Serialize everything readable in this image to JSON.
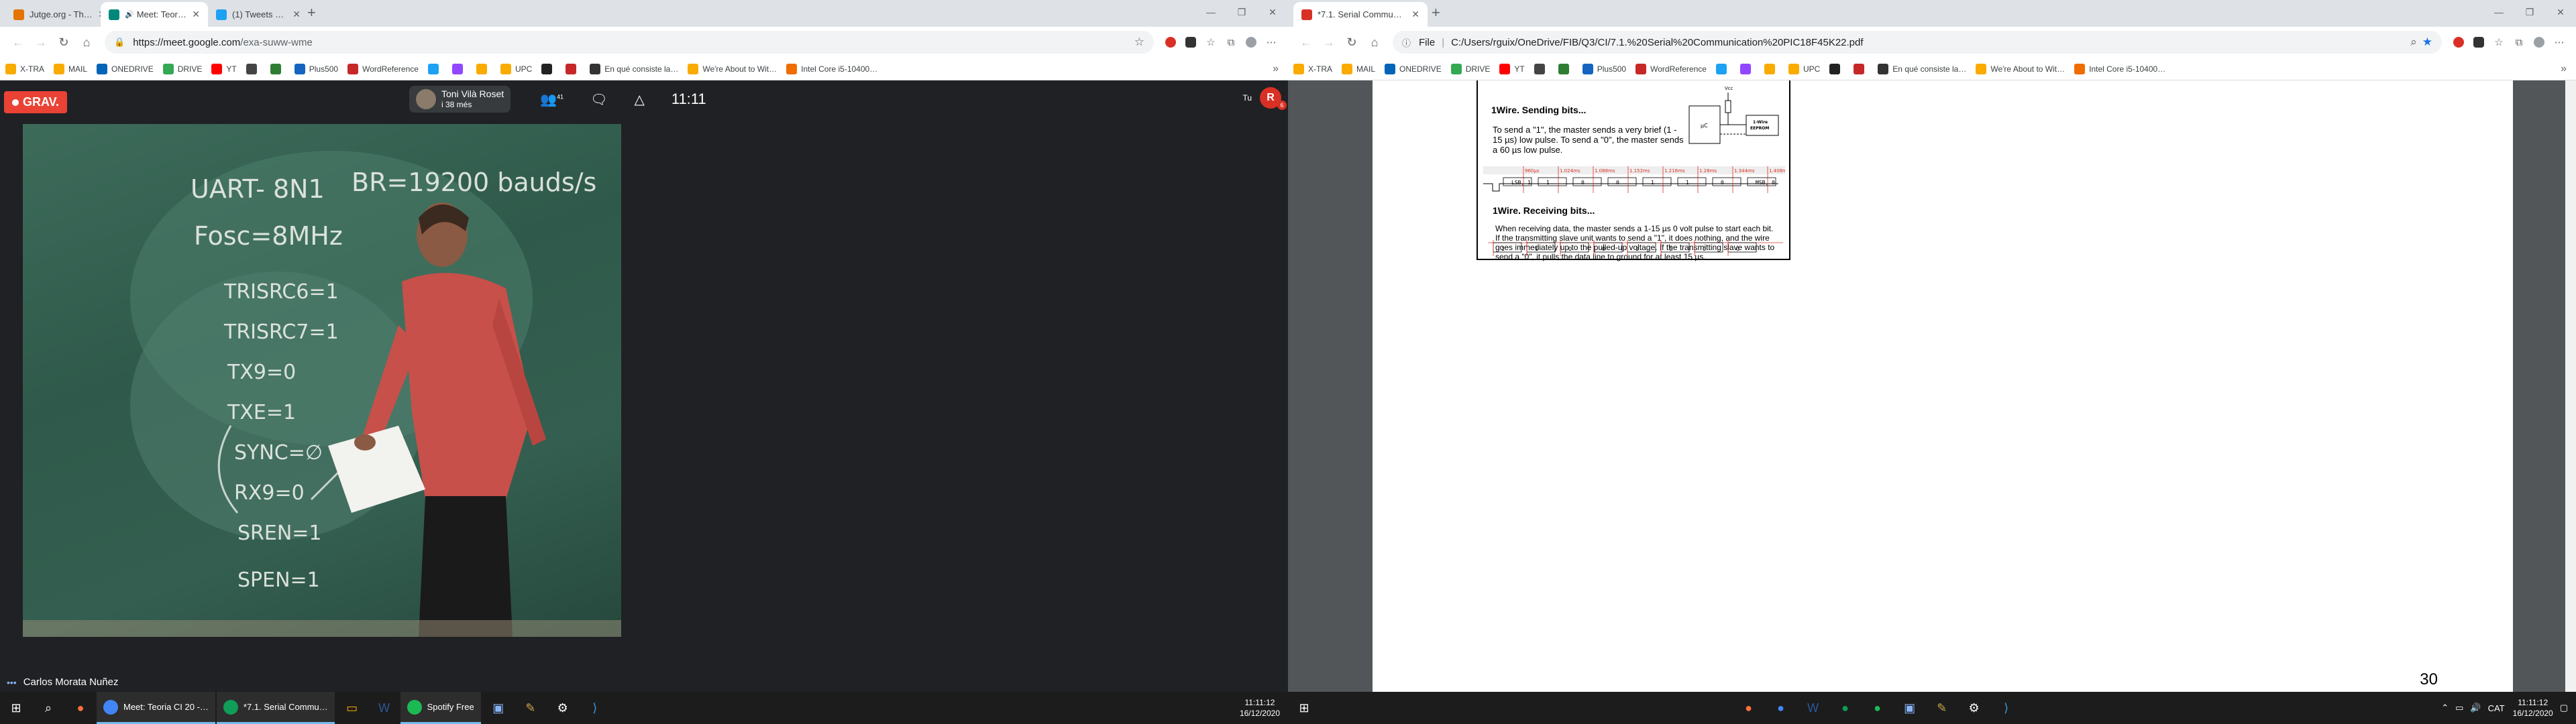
{
  "left_screen": {
    "tabs": [
      {
        "title": "Jutge.org - The Purge FIB Q1 20…",
        "fav_color": "#e37400",
        "active": false
      },
      {
        "title": "Meet: Teoria CI 20 - Busos",
        "fav_color": "#00897b",
        "active": true,
        "audio": "🔊"
      },
      {
        "title": "(1) Tweets más recientes / Twitt…",
        "fav_color": "#1da1f2",
        "active": false
      }
    ],
    "url": {
      "host": "https://meet.google.com",
      "rest": "/exa-suww-wme"
    },
    "bookmarks": [
      {
        "label": "X-TRA",
        "color": "#f9ab00"
      },
      {
        "label": "MAIL",
        "color": "#f9ab00"
      },
      {
        "label": "ONEDRIVE",
        "color": "#0364b8"
      },
      {
        "label": "DRIVE",
        "color": "#34a853"
      },
      {
        "label": "YT",
        "color": "#ff0000"
      },
      {
        "label": "",
        "color": "#444"
      },
      {
        "label": "",
        "color": "#2e7d32"
      },
      {
        "label": "Plus500",
        "color": "#1565c0"
      },
      {
        "label": "WordReference",
        "color": "#c62828"
      },
      {
        "label": "",
        "color": "#1da1f2"
      },
      {
        "label": "",
        "color": "#9146ff"
      },
      {
        "label": "",
        "color": "#f9ab00"
      },
      {
        "label": "UPC",
        "color": "#f9ab00"
      },
      {
        "label": "",
        "color": "#222"
      },
      {
        "label": "",
        "color": "#c62828"
      },
      {
        "label": "En qué consiste la…",
        "color": "#333"
      },
      {
        "label": "We're About to Wit…",
        "color": "#f9ab00"
      },
      {
        "label": "Intel Core i5-10400…",
        "color": "#ef6c00"
      }
    ],
    "meet": {
      "recording_label": "GRAV.",
      "presenter_name": "Toni Vilà Roset",
      "presenter_sub": "i 38 més",
      "participants_count": "41",
      "time": "11:11",
      "you_label": "Tu",
      "avatar_initial": "R",
      "notification_count": "6",
      "speaker_name": "Carlos Morata Nuñez"
    },
    "blackboard": [
      "UART- 8N1",
      "BR=19200 bauds/s",
      "Fosc=8MHz",
      "TRISRC6=1",
      "TRISRC7=1",
      "TX9=0",
      "TXE=1",
      "SYNC=∅",
      "RX9=0",
      "SREN=1",
      "SPEN=1"
    ],
    "taskbar": {
      "apps": [
        {
          "label": "Meet: Teoria CI 20 -…",
          "color": "#4285f4"
        },
        {
          "label": "*7.1. Serial Commu…",
          "color": "#0f9d58"
        },
        {
          "label": "Spotify Free",
          "color": "#1db954"
        }
      ],
      "time": "11:11:12",
      "date": "16/12/2020"
    }
  },
  "right_screen": {
    "tabs": [
      {
        "title": "*7.1. Serial Communication PIC1…",
        "fav_color": "#d93025",
        "active": true
      }
    ],
    "url": {
      "host": "File",
      "rest": "C:/Users/rguix/OneDrive/FIB/Q3/CI/7.1.%20Serial%20Communication%20PIC18F45K22.pdf"
    },
    "pdf": {
      "sending_title": "1Wire. Sending bits...",
      "sending_text": [
        "To send a \"1\", the master sends a very brief (1 -",
        "15 µs) low pulse. To send a \"0\", the master sends",
        "a 60 µs low pulse."
      ],
      "diagram": {
        "vcc": "Vcc",
        "mcu": "µC",
        "eeprom_l1": "1-Wire",
        "eeprom_l2": "EEPROM"
      },
      "timestamps": [
        "960µs",
        "1.024ms",
        "1.088ms",
        "1.152ms",
        "1.216ms",
        "1.28ms",
        "1.344ms",
        "1.408ms",
        "1.472ms"
      ],
      "send_bits": [
        "LSB, 1",
        "1",
        "0",
        "0",
        "1",
        "1",
        "0",
        "MSB, 0"
      ],
      "receiving_title": "1Wire. Receiving bits...",
      "receiving_text": [
        "When receiving data, the master sends a 1-15 µs 0 volt pulse to start each bit.",
        "If the transmitting slave unit wants to send a \"1\", it does nothing, and the wire",
        "goes immediately up to the pulled-up voltage. If the transmitting slave wants to",
        "send a \"0\", it pulls the data line to ground for at least 15 µs."
      ],
      "recv_bits": [
        "1",
        "1",
        "0",
        "0",
        "1",
        "1",
        "0",
        "0"
      ],
      "page_number": "30"
    },
    "taskbar": {
      "lang": "CAT",
      "time": "11:11:12",
      "date": "16/12/2020"
    }
  }
}
